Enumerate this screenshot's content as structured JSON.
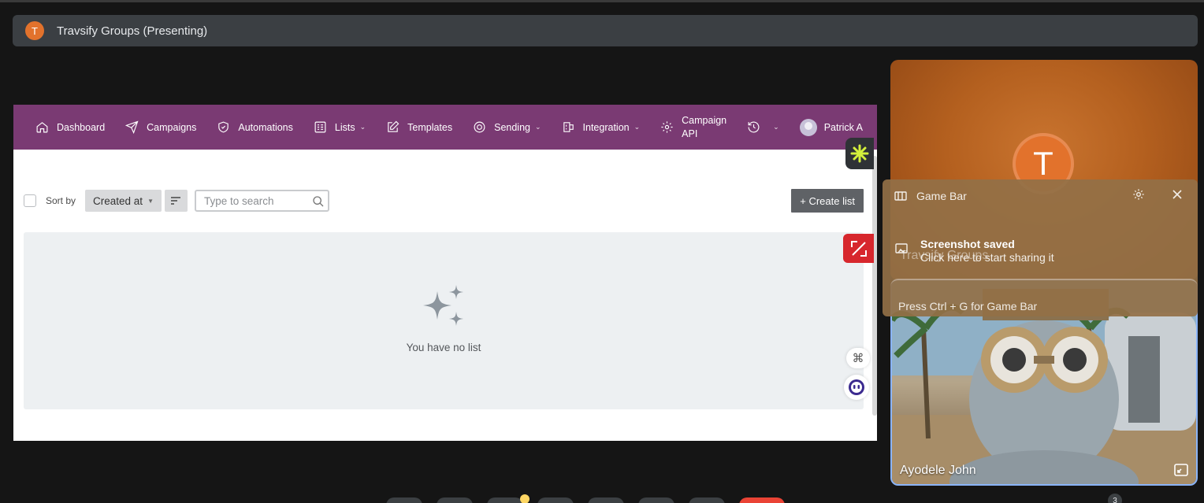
{
  "meeting": {
    "avatar_letter": "T",
    "title": "Travsify Groups (Presenting)"
  },
  "nav": {
    "items": [
      {
        "label": "Dashboard",
        "icon": "home-icon"
      },
      {
        "label": "Campaigns",
        "icon": "send-icon"
      },
      {
        "label": "Automations",
        "icon": "shield-icon"
      },
      {
        "label": "Lists",
        "icon": "list-icon",
        "dropdown": true
      },
      {
        "label": "Templates",
        "icon": "edit-icon"
      },
      {
        "label": "Sending",
        "icon": "target-icon",
        "dropdown": true
      },
      {
        "label": "Integration",
        "icon": "integration-icon",
        "dropdown": true
      }
    ],
    "campaign_api_line1": "Campaign",
    "campaign_api_line2": "API",
    "user_name": "Patrick A"
  },
  "toolbar": {
    "sort_by_label": "Sort by",
    "sort_value": "Created at",
    "search_placeholder": "Type to search",
    "create_label": "+ Create list"
  },
  "empty_state": {
    "message": "You have no list"
  },
  "participants": {
    "presenter_letter": "T",
    "camera_name": "Ayodele John"
  },
  "game_bar": {
    "title": "Game Bar",
    "toast_title": "Screenshot saved",
    "toast_body": "Click here to start sharing it",
    "ghost_text": "Travsify Groups",
    "hint": "Press Ctrl + G for Game Bar"
  },
  "badge_count": "3",
  "colors": {
    "nav_bg": "#7a3a73",
    "presenter_avatar": "#e2722c",
    "create_button": "#5f6266"
  }
}
